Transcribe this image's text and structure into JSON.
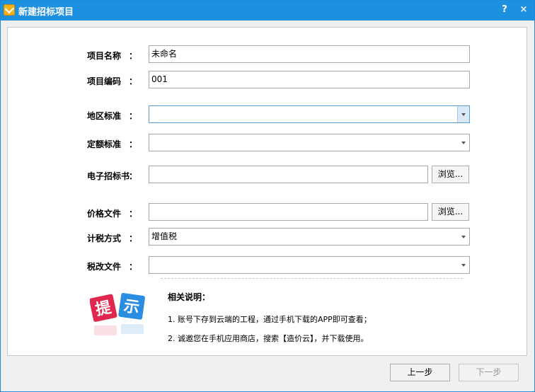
{
  "window": {
    "title": "新建招标项目",
    "help": "?",
    "close": "×"
  },
  "form": {
    "project_name": {
      "label": "项目名称",
      "colon": "：",
      "value": "未命名"
    },
    "project_code": {
      "label": "项目编码",
      "colon": "：",
      "value": "001"
    },
    "region_standard": {
      "label": "地区标准",
      "colon": "：",
      "value": ""
    },
    "quota_standard": {
      "label": "定额标准",
      "colon": "：",
      "value": ""
    },
    "e_tender": {
      "label": "电子招标书",
      "colon": "：",
      "value": "",
      "browse": "浏览..."
    },
    "price_file": {
      "label": "价格文件",
      "colon": "：",
      "value": "",
      "browse": "浏览..."
    },
    "tax_method": {
      "label": "计税方式",
      "colon": "：",
      "value": "增值税"
    },
    "tax_reform_file": {
      "label": "税改文件",
      "colon": "：",
      "value": ""
    }
  },
  "tips": {
    "logo_text_1": "提",
    "logo_text_2": "示",
    "heading": "相关说明：",
    "lines": [
      "1. 账号下存到云端的工程，通过手机下载的APP即可查看；",
      "2. 诚邀您在手机应用商店，搜索【造价云】，并下载使用。"
    ]
  },
  "footer": {
    "prev": "上一步",
    "next": "下一步"
  },
  "colors": {
    "titlebar": "#1e90e0",
    "accent_red": "#e0284f",
    "accent_blue": "#2a8de0"
  }
}
